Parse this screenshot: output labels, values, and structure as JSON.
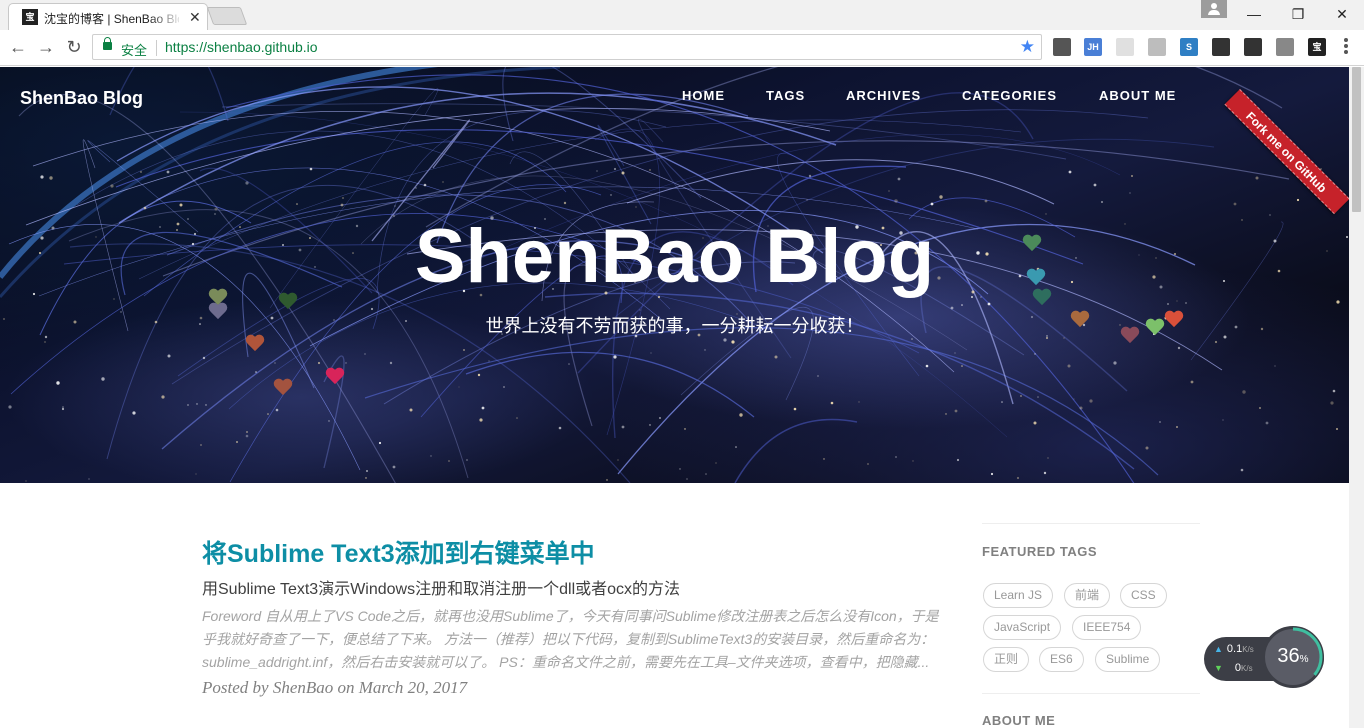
{
  "browser": {
    "tab_title": "沈宝的博客 | ShenBao Blog",
    "tab_favicon": "宝",
    "secure_label": "安全",
    "url": "https://shenbao.github.io",
    "extensions": [
      {
        "name": "eye-extension-icon",
        "label": "",
        "color": "#555555"
      },
      {
        "name": "jh-extension-icon",
        "label": "JH",
        "color": "#4a7fd6"
      },
      {
        "name": "calendar-extension-icon",
        "label": "",
        "color": "#e0e0e0"
      },
      {
        "name": "pdf-extension-icon",
        "label": "",
        "color": "#bdbdbd"
      },
      {
        "name": "s-extension-icon",
        "label": "S",
        "color": "#2f7fc4"
      },
      {
        "name": "qrcode-extension-icon",
        "label": "",
        "color": "#333333"
      },
      {
        "name": "mask-extension-icon",
        "label": "",
        "color": "#333333"
      },
      {
        "name": "puzzle-extension-icon",
        "label": "",
        "color": "#888888"
      },
      {
        "name": "bao-extension-icon",
        "label": "宝",
        "color": "#222222"
      }
    ]
  },
  "site": {
    "brand": "ShenBao Blog",
    "nav": [
      "HOME",
      "TAGS",
      "ARCHIVES",
      "CATEGORIES",
      "ABOUT ME"
    ],
    "fork_ribbon": "Fork me on GitHub",
    "hero_title": "ShenBao Blog",
    "hero_subtitle": "世界上没有不劳而获的事，一分耕耘一分收获！"
  },
  "hearts": [
    "#7a8b5a",
    "#6d6b8e",
    "#2f5a2f",
    "#b0553a",
    "#a3533f",
    "#d8245a",
    "#4b8a5a",
    "#3a9ab0",
    "#2e6e5e",
    "#a96a3e",
    "#8a4a5a",
    "#7cc06a",
    "#d9503a"
  ],
  "post": {
    "title": "将Sublime Text3添加到右键菜单中",
    "subtitle": "用Sublime Text3演示Windows注册和取消注册一个dll或者ocx的方法",
    "excerpt": "Foreword 自从用上了VS Code之后，就再也没用Sublime了，今天有同事问Sublime修改注册表之后怎么没有Icon，于是乎我就好奇查了一下，便总结了下来。 方法一（推荐）把以下代码，复制到SublimeText3的安装目录，然后重命名为：sublime_addright.inf，然后右击安装就可以了。 PS：重命名文件之前，需要先在工具–文件夹选项，查看中，把隐藏...",
    "meta": "Posted by ShenBao on March 20, 2017"
  },
  "sidebar": {
    "featured_tags_heading": "FEATURED TAGS",
    "tags": [
      "Learn JS",
      "前端",
      "CSS",
      "JavaScript",
      "IEEE754",
      "正则",
      "ES6",
      "Sublime"
    ],
    "about_heading": "ABOUT ME"
  },
  "netspeed": {
    "upload": "0.1",
    "download": "0",
    "unit": "K/s",
    "percent": "36",
    "percent_sign": "%"
  }
}
